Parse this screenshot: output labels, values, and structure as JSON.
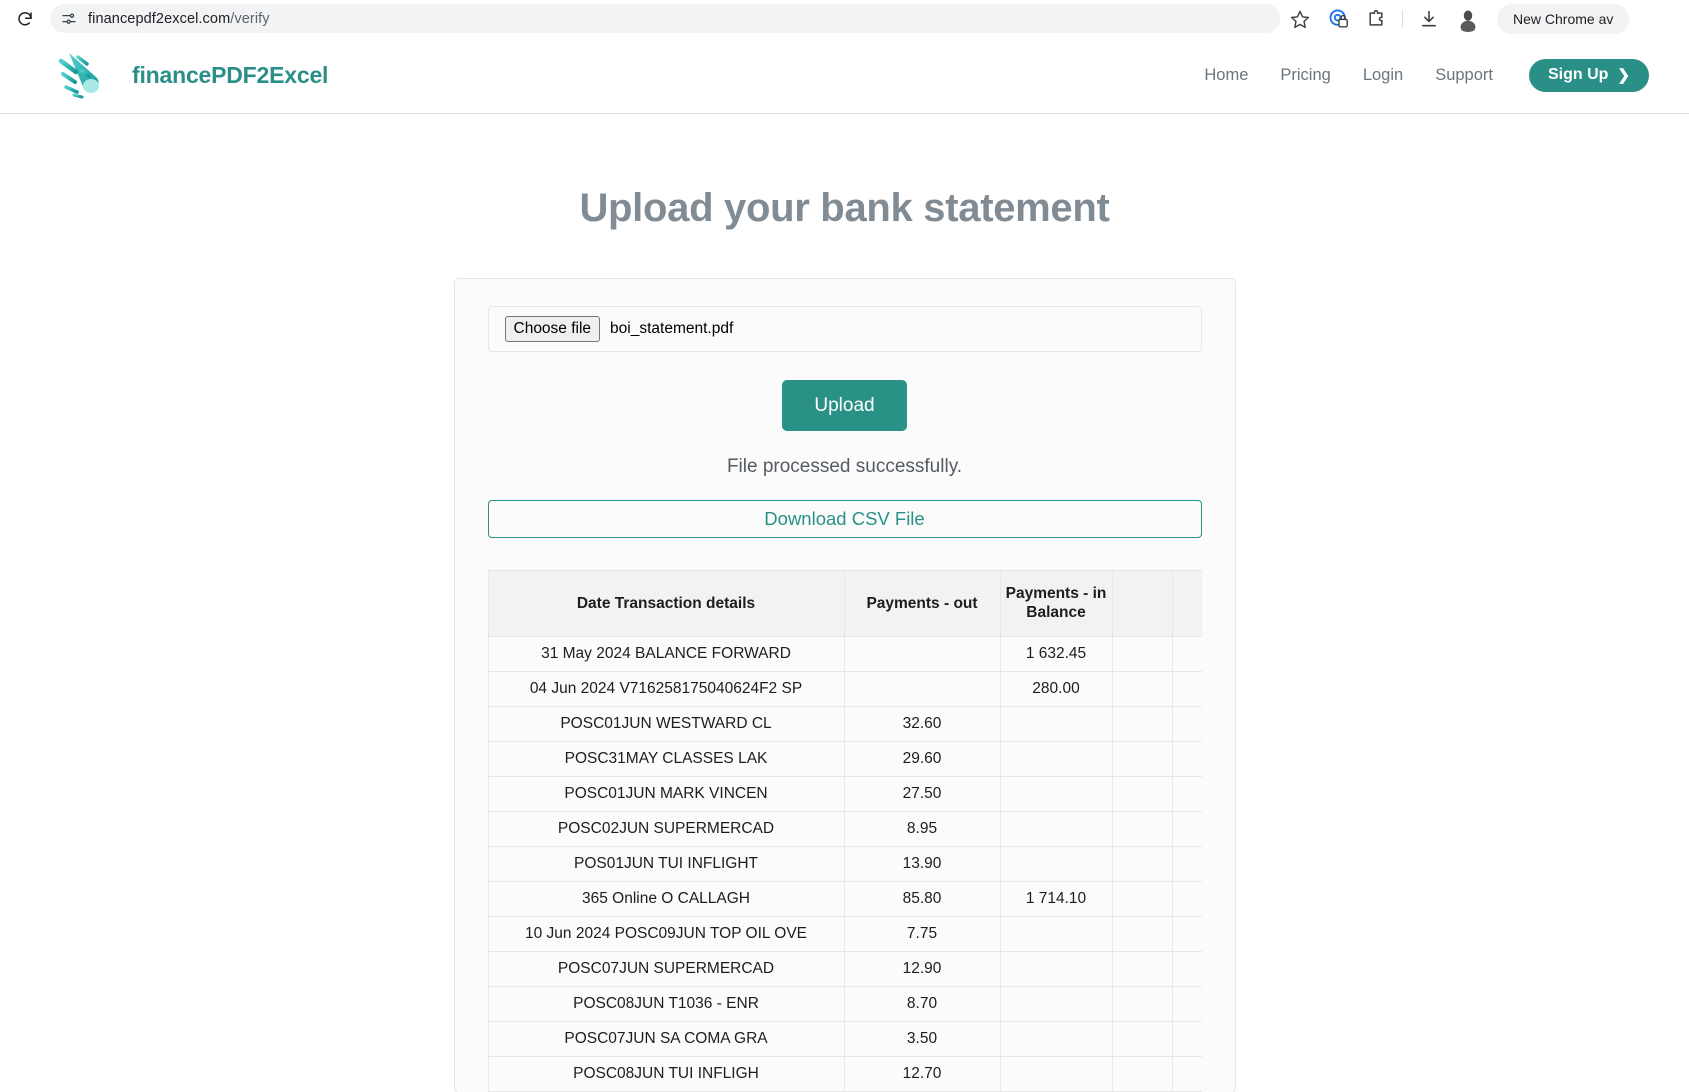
{
  "browser": {
    "reload_icon": "reload-icon",
    "site_settings_icon": "site-settings-icon",
    "url_domain": "financepdf2excel.com",
    "url_path": "/verify",
    "star_icon": "star-icon",
    "password_manager_icon": "password-manager-icon",
    "extensions_icon": "extensions-puzzle-icon",
    "downloads_icon": "downloads-icon",
    "profile_icon": "profile-avatar-icon",
    "update_pill": "New Chrome av"
  },
  "header": {
    "logo_icon": "comet-logo-icon",
    "brand": "financePDF2Excel",
    "nav": [
      {
        "label": "Home"
      },
      {
        "label": "Pricing"
      },
      {
        "label": "Login"
      },
      {
        "label": "Support"
      }
    ],
    "signup_label": "Sign Up",
    "signup_chevron": "chevron-right-icon",
    "accent_color": "#2a8f86"
  },
  "main": {
    "title": "Upload your bank statement",
    "choose_file_label": "Choose file",
    "file_name": "boi_statement.pdf",
    "upload_label": "Upload",
    "status": "File processed successfully.",
    "download_label": "Download CSV File"
  },
  "table": {
    "headers": [
      "Date Transaction details",
      "Payments - out",
      "Payments - in Balance",
      "",
      "",
      ""
    ],
    "rows": [
      {
        "details": "31 May 2024 BALANCE FORWARD",
        "out": "",
        "in": "1 632.45",
        "x1": "",
        "x2": "",
        "x3": ""
      },
      {
        "details": "04 Jun 2024 V716258175040624F2 SP",
        "out": "",
        "in": "280.00",
        "x1": "",
        "x2": "",
        "x3": ""
      },
      {
        "details": "POSC01JUN WESTWARD CL",
        "out": "32.60",
        "in": "",
        "x1": "",
        "x2": "",
        "x3": ""
      },
      {
        "details": "POSC31MAY CLASSES LAK",
        "out": "29.60",
        "in": "",
        "x1": "",
        "x2": "",
        "x3": ""
      },
      {
        "details": "POSC01JUN MARK VINCEN",
        "out": "27.50",
        "in": "",
        "x1": "",
        "x2": "",
        "x3": ""
      },
      {
        "details": "POSC02JUN SUPERMERCAD",
        "out": "8.95",
        "in": "",
        "x1": "",
        "x2": "",
        "x3": ""
      },
      {
        "details": "POS01JUN TUI INFLIGHT",
        "out": "13.90",
        "in": "",
        "x1": "",
        "x2": "",
        "x3": ""
      },
      {
        "details": "365 Online O CALLAGH",
        "out": "85.80",
        "in": "1 714.10",
        "x1": "",
        "x2": "",
        "x3": ""
      },
      {
        "details": "10 Jun 2024 POSC09JUN TOP OIL OVE",
        "out": "7.75",
        "in": "",
        "x1": "",
        "x2": "",
        "x3": ""
      },
      {
        "details": "POSC07JUN SUPERMERCAD",
        "out": "12.90",
        "in": "",
        "x1": "",
        "x2": "",
        "x3": ""
      },
      {
        "details": "POSC08JUN T1036 - ENR",
        "out": "8.70",
        "in": "",
        "x1": "",
        "x2": "",
        "x3": ""
      },
      {
        "details": "POSC07JUN SA COMA GRA",
        "out": "3.50",
        "in": "",
        "x1": "",
        "x2": "",
        "x3": ""
      },
      {
        "details": "POSC08JUN TUI INFLIGH",
        "out": "12.70",
        "in": "",
        "x1": "",
        "x2": "",
        "x3": ""
      }
    ]
  }
}
